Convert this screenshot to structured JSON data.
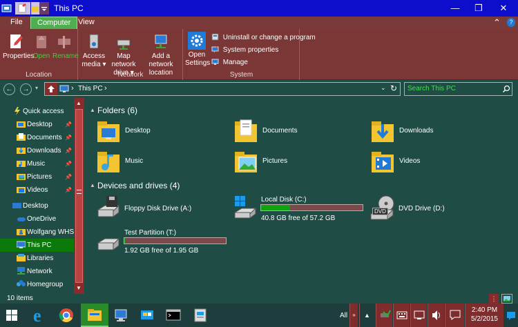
{
  "window": {
    "title": "This PC",
    "minimize_glyph": "—",
    "maximize_glyph": "❐",
    "close_glyph": "✕"
  },
  "ribbon_tabs": [
    {
      "label": "File"
    },
    {
      "label": "Computer"
    },
    {
      "label": "View"
    }
  ],
  "ribbon": {
    "collapse_glyph": "⌃",
    "help_glyph": "?",
    "location": {
      "label": "Location",
      "properties": "Properties",
      "open": "Open",
      "rename": "Rename"
    },
    "network": {
      "label": "Network",
      "access_media": "Access media ▾",
      "map_network_drive": "Map network drive ▾",
      "add_network_location": "Add a network location"
    },
    "system": {
      "label": "System",
      "open_settings": "Open Settings",
      "uninstall": "Uninstall or change a program",
      "system_properties": "System properties",
      "manage": "Manage"
    }
  },
  "address": {
    "path_root": "This PC",
    "chevron": "›",
    "search_placeholder": "Search This PC"
  },
  "nav_pane": {
    "items": [
      {
        "label": "Quick access",
        "icon": "star-icon"
      },
      {
        "label": "Desktop",
        "icon": "desktop-folder-icon",
        "pinned": true
      },
      {
        "label": "Documents",
        "icon": "documents-folder-icon",
        "pinned": true
      },
      {
        "label": "Downloads",
        "icon": "downloads-folder-icon",
        "pinned": true
      },
      {
        "label": "Music",
        "icon": "music-folder-icon",
        "pinned": true
      },
      {
        "label": "Pictures",
        "icon": "pictures-folder-icon",
        "pinned": true
      },
      {
        "label": "Videos",
        "icon": "videos-folder-icon",
        "pinned": true
      },
      {
        "label": "Desktop",
        "icon": "desktop-icon"
      },
      {
        "label": "OneDrive",
        "icon": "onedrive-icon"
      },
      {
        "label": "Wolfgang WHS",
        "icon": "user-folder-icon"
      },
      {
        "label": "This PC",
        "icon": "computer-icon",
        "selected": true
      },
      {
        "label": "Libraries",
        "icon": "libraries-icon"
      },
      {
        "label": "Network",
        "icon": "network-icon"
      },
      {
        "label": "Homegroup",
        "icon": "homegroup-icon"
      }
    ]
  },
  "folders": {
    "heading": "Folders (6)",
    "items": [
      {
        "label": "Desktop"
      },
      {
        "label": "Documents"
      },
      {
        "label": "Downloads"
      },
      {
        "label": "Music"
      },
      {
        "label": "Pictures"
      },
      {
        "label": "Videos"
      }
    ]
  },
  "drives": {
    "heading": "Devices and drives (4)",
    "items": [
      {
        "label": "Floppy Disk Drive (A:)"
      },
      {
        "label": "Local Disk (C:)",
        "free_text": "40.8 GB free of 57.2 GB",
        "used_fraction": 0.287
      },
      {
        "label": "DVD Drive (D:)",
        "badge": "DVD"
      },
      {
        "label": "Test Partition (T:)",
        "free_text": "1.92 GB free of 1.95 GB",
        "used_fraction": 0.015
      }
    ]
  },
  "status": {
    "item_count": "10 items"
  },
  "taskbar": {
    "all_label": "All",
    "time": "2:40 PM",
    "date": "5/2/2015"
  },
  "colors": {
    "titlebar": "#0d0dcc",
    "ribbon": "#7b3636",
    "content_bg": "#1f4c45",
    "selection": "#0b7a0b",
    "drive_bar_fill": "#0fa30f",
    "search_text": "#3fe23f"
  }
}
